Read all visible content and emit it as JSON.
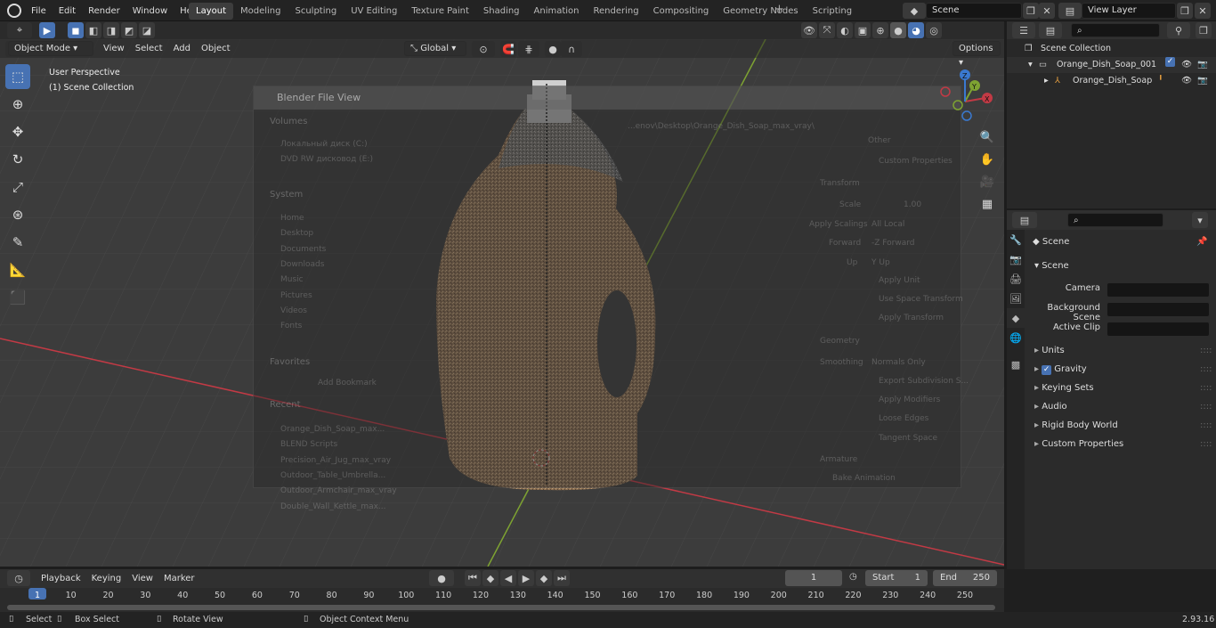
{
  "topbar": {
    "menus": [
      "File",
      "Edit",
      "Render",
      "Window",
      "Help"
    ],
    "workspaces": [
      "Layout",
      "Modeling",
      "Sculpting",
      "UV Editing",
      "Texture Paint",
      "Shading",
      "Animation",
      "Rendering",
      "Compositing",
      "Geometry Nodes",
      "Scripting"
    ],
    "active_workspace": "Layout",
    "scene_name": "Scene",
    "view_layer": "View Layer"
  },
  "viewport": {
    "mode": "Object Mode",
    "menus": [
      "View",
      "Select",
      "Add",
      "Object"
    ],
    "orientation": "Global",
    "options_label": "Options",
    "perspective_label": "User Perspective",
    "collection_label": "(1) Scene Collection",
    "gizmo": {
      "x": "X",
      "y": "Y",
      "z": "Z"
    }
  },
  "file_view": {
    "title": "Blender File View",
    "path": "...enov\\Desktop\\Orange_Dish_Soap_max_vray\\",
    "volumes_header": "Volumes",
    "volumes": [
      "Локальный диск (C:)",
      "DVD RW дисковод (E:)"
    ],
    "system_header": "System",
    "system": [
      "Home",
      "Desktop",
      "Documents",
      "Downloads",
      "Music",
      "Pictures",
      "Videos",
      "Fonts"
    ],
    "favorites_header": "Favorites",
    "add_bookmark": "Add Bookmark",
    "recent_header": "Recent",
    "recent": [
      "Orange_Dish_Soap_max...",
      "BLEND Scripts",
      "Precision_Air_Jug_max_vray",
      "Outdoor_Table_Umbrella...",
      "Outdoor_Armchair_max_vray",
      "Double_Wall_Kettle_max..."
    ],
    "opts": {
      "other_label": "Other",
      "custom_props": "Custom Properties",
      "transform_header": "Transform",
      "scale_label": "Scale",
      "scale_value": "1.00",
      "apply_scalings_label": "Apply Scalings",
      "apply_scalings_value": "All Local",
      "forward_label": "Forward",
      "forward_value": "-Z Forward",
      "up_label": "Up",
      "up_value": "Y Up",
      "apply_unit": "Apply Unit",
      "use_space_transform": "Use Space Transform",
      "apply_transform": "Apply Transform",
      "geometry_header": "Geometry",
      "smoothing_label": "Smoothing",
      "smoothing_value": "Normals Only",
      "export_subdiv": "Export Subdivision S...",
      "apply_modifiers": "Apply Modifiers",
      "loose_edges": "Loose Edges",
      "tangent_space": "Tangent Space",
      "armature_header": "Armature",
      "bake_animation": "Bake Animation"
    }
  },
  "outliner": {
    "root": "Scene Collection",
    "collection": "Orange_Dish_Soap_001",
    "object": "Orange_Dish_Soap"
  },
  "properties": {
    "header": "Scene",
    "section": "Scene",
    "fields": [
      {
        "label": "Camera",
        "value": ""
      },
      {
        "label": "Background Scene",
        "value": ""
      },
      {
        "label": "Active Clip",
        "value": ""
      }
    ],
    "panels": [
      "Units",
      "Gravity",
      "Keying Sets",
      "Audio",
      "Rigid Body World",
      "Custom Properties"
    ]
  },
  "timeline": {
    "menus": [
      "Playback",
      "Keying",
      "View",
      "Marker"
    ],
    "current_frame": "1",
    "start_label": "Start",
    "start": "1",
    "end_label": "End",
    "end": "250",
    "ticks": [
      "1",
      "10",
      "20",
      "30",
      "40",
      "50",
      "60",
      "70",
      "80",
      "90",
      "100",
      "110",
      "120",
      "130",
      "140",
      "150",
      "160",
      "170",
      "180",
      "190",
      "200",
      "210",
      "220",
      "230",
      "240",
      "250"
    ]
  },
  "status": {
    "select": "Select",
    "box_select": "Box Select",
    "rotate_view": "Rotate View",
    "context_menu": "Object Context Menu",
    "version": "2.93.16"
  },
  "colors": {
    "accent": "#4772b3",
    "x_axis": "#c23a45",
    "y_axis": "#7ea332",
    "bottle": "#9a7b5a"
  }
}
